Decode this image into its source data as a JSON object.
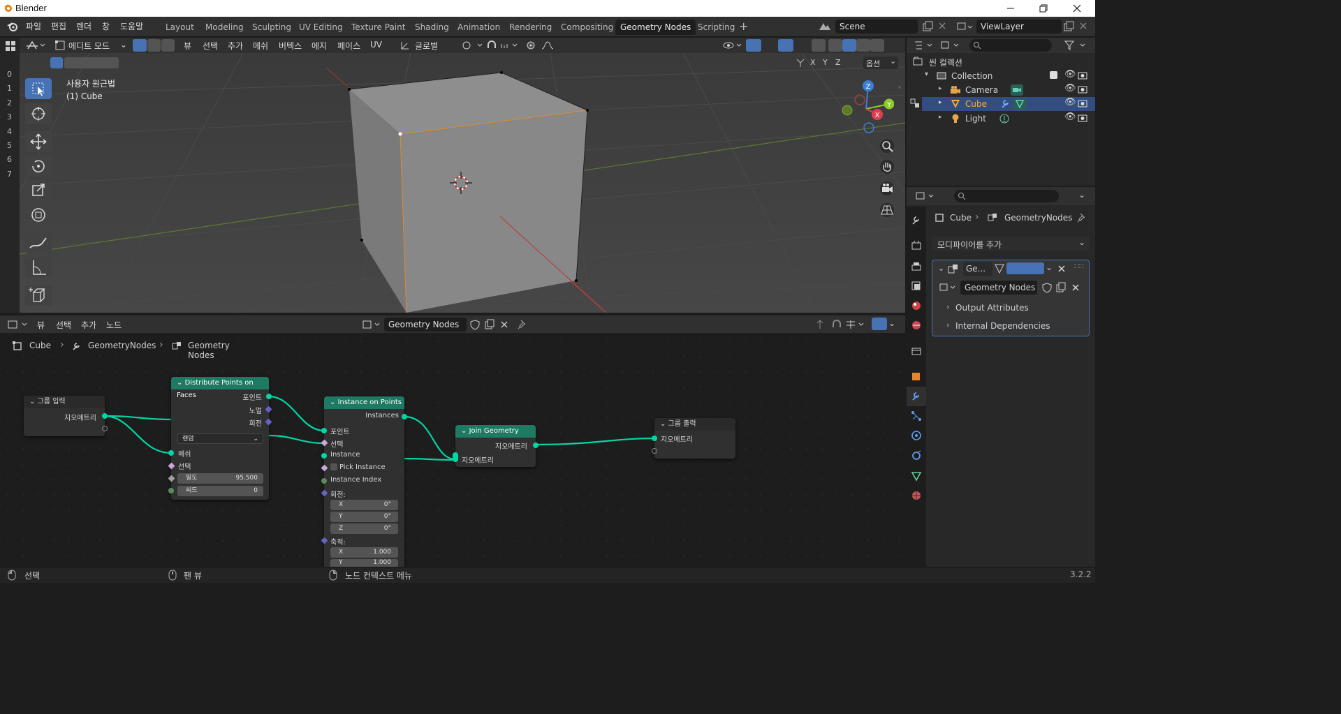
{
  "window": {
    "title": "Blender"
  },
  "menus": [
    "파일",
    "편집",
    "렌더",
    "창",
    "도움말"
  ],
  "workspaces": [
    "Layout",
    "Modeling",
    "Sculpting",
    "UV Editing",
    "Texture Paint",
    "Shading",
    "Animation",
    "Rendering",
    "Compositing",
    "Geometry Nodes",
    "Scripting"
  ],
  "active_workspace": "Geometry Nodes",
  "scene": {
    "name": "Scene",
    "view_layer": "ViewLayer"
  },
  "viewport": {
    "mode": "에디트 모드",
    "menus": [
      "뷰",
      "선택",
      "추가",
      "메쉬",
      "버텍스",
      "에지",
      "페이스",
      "UV"
    ],
    "transform_orientation": "글로벌",
    "options_label": "옵션",
    "axis_toggles": [
      "X",
      "Y",
      "Z"
    ],
    "view_name": "사용자 원근법",
    "object_info": "(1) Cube",
    "gizmo": {
      "x": "X",
      "y": "Y",
      "z": "Z"
    },
    "row_numbers": [
      "0",
      "1",
      "2",
      "3",
      "4",
      "5",
      "6",
      "7"
    ]
  },
  "outliner": {
    "scene_collection": "씬 컬렉션",
    "collection": "Collection",
    "items": [
      {
        "name": "Camera",
        "selected": false
      },
      {
        "name": "Cube",
        "selected": true
      },
      {
        "name": "Light",
        "selected": false
      }
    ]
  },
  "properties": {
    "breadcrumb": {
      "object": "Cube",
      "modifier": "GeometryNodes"
    },
    "add_modifier": "모디파이어를 추가",
    "modifier_short_name": "Ge...",
    "node_group": "Geometry Nodes",
    "panels": [
      "Output Attributes",
      "Internal Dependencies"
    ]
  },
  "node_editor": {
    "menus": [
      "뷰",
      "선택",
      "추가",
      "노드"
    ],
    "node_group": "Geometry Nodes",
    "breadcrumb": [
      "Cube",
      "GeometryNodes",
      "Geometry Nodes"
    ],
    "nodes": {
      "group_input": {
        "title": "그룹 입력",
        "output": "지오메트리"
      },
      "distribute": {
        "title": "Distribute Points on Faces",
        "outputs": [
          "포인트",
          "노멀",
          "회전"
        ],
        "mode": "랜덤",
        "inputs": [
          "메쉬",
          "선택"
        ],
        "density_label": "밀도",
        "density_value": "95.500",
        "seed_label": "씨드",
        "seed_value": "0"
      },
      "instance_on_points": {
        "title": "Instance on Points",
        "output": "Instances",
        "inputs": [
          "포인트",
          "선택",
          "Instance",
          "Pick Instance",
          "Instance Index"
        ],
        "rotation_label": "회전:",
        "rotation": [
          {
            "axis": "X",
            "value": "0°"
          },
          {
            "axis": "Y",
            "value": "0°"
          },
          {
            "axis": "Z",
            "value": "0°"
          }
        ],
        "scale_label": "축적:",
        "scale": [
          {
            "axis": "X",
            "value": "1.000"
          },
          {
            "axis": "Y",
            "value": "1.000"
          }
        ]
      },
      "join_geometry": {
        "title": "Join Geometry",
        "output": "지오메트리",
        "input": "지오메트리"
      },
      "group_output": {
        "title": "그룹 출력",
        "input": "지오메트리"
      }
    }
  },
  "statusbar": {
    "select": "선택",
    "pan": "팬 뷰",
    "context_menu": "노드 컨텍스트 메뉴",
    "version": "3.2.2"
  },
  "colors": {
    "accent": "#4772b3",
    "geometry_socket": "#00d6a3",
    "geometry_node_header": "#1e7a63",
    "selected_object": "#ffaf29"
  }
}
